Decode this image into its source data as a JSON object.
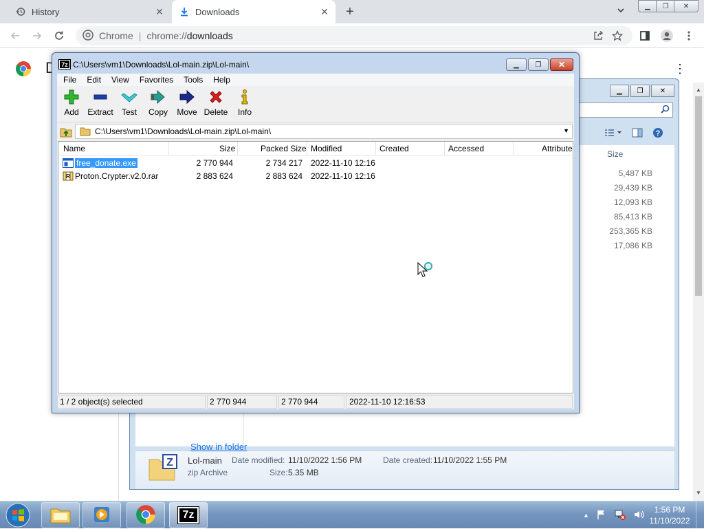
{
  "chrome": {
    "tabs": [
      {
        "label": "History",
        "icon": "history-icon"
      },
      {
        "label": "Downloads",
        "icon": "download-icon"
      }
    ],
    "omnibox": {
      "chip": "Chrome",
      "url_scheme": "chrome://",
      "url_host": "downloads"
    },
    "page": {
      "title_letter": "D",
      "show_in_folder": "Show in folder"
    }
  },
  "explorer": {
    "size_header": "Size",
    "sizes": [
      "5,487 KB",
      "29,439 KB",
      "12,093 KB",
      "85,413 KB",
      "253,365 KB",
      "17,086 KB"
    ],
    "details": {
      "name": "Lol-main",
      "type": "zip Archive",
      "date_modified_label": "Date modified:",
      "date_modified": "11/10/2022 1:56 PM",
      "date_created_label": "Date created:",
      "date_created": "11/10/2022 1:55 PM",
      "size_label": "Size:",
      "size": "5.35 MB"
    }
  },
  "sevenzip": {
    "title": "C:\\Users\\vm1\\Downloads\\Lol-main.zip\\Lol-main\\",
    "menu": [
      "File",
      "Edit",
      "View",
      "Favorites",
      "Tools",
      "Help"
    ],
    "toolbar": [
      "Add",
      "Extract",
      "Test",
      "Copy",
      "Move",
      "Delete",
      "Info"
    ],
    "address": "C:\\Users\\vm1\\Downloads\\Lol-main.zip\\Lol-main\\",
    "columns": [
      "Name",
      "Size",
      "Packed Size",
      "Modified",
      "Created",
      "Accessed",
      "Attribute"
    ],
    "files": [
      {
        "name": "free_donate.exe",
        "size": "2 770 944",
        "packed": "2 734 217",
        "modified": "2022-11-10 12:16"
      },
      {
        "name": "Proton.Crypter.v2.0.rar",
        "size": "2 883 624",
        "packed": "2 883 624",
        "modified": "2022-11-10 12:16"
      }
    ],
    "status": {
      "selected": "1 / 2 object(s) selected",
      "size": "2 770 944",
      "packed": "2 770 944",
      "modified": "2022-11-10 12:16:53"
    }
  },
  "taskbar": {
    "time": "1:56 PM",
    "date": "11/10/2022",
    "sevenzip_label": "7z"
  }
}
